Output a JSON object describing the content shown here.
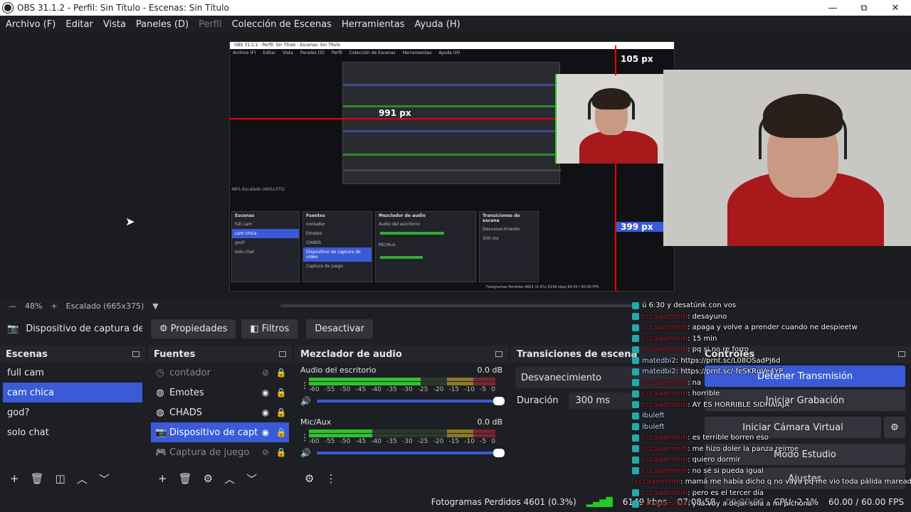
{
  "window": {
    "title": "OBS 31.1.2 - Perfil: Sin Título - Escenas: Sin Título",
    "controls": [
      "—",
      "⧉",
      "✕"
    ]
  },
  "menu": [
    {
      "label": "Archivo (F)",
      "disabled": false
    },
    {
      "label": "Editar",
      "disabled": false
    },
    {
      "label": "Vista",
      "disabled": false
    },
    {
      "label": "Paneles (D)",
      "disabled": false
    },
    {
      "label": "Perfil",
      "disabled": true
    },
    {
      "label": "Colección de Escenas",
      "disabled": false
    },
    {
      "label": "Herramientas",
      "disabled": false
    },
    {
      "label": "Ayuda (H)",
      "disabled": false
    }
  ],
  "preview": {
    "measure_top": "105 px",
    "measure_left": "991 px",
    "measure_right": "399 px",
    "nested_title": "OBS 31.1.2 - Perfil: Sin Título - Escenas: Sin Título",
    "nested_menu": [
      "Archivo (F)",
      "Editar",
      "Vista",
      "Paneles (D)",
      "Perfil",
      "Colección de Escenas",
      "Herramientas",
      "Ayuda (H)"
    ],
    "nested_scale": "48%  Escalado (665x375)",
    "nested_status": "Fotogramas Perdidos 4601 (0.3%)   6149 kbps   60.00 / 60.00 FPS"
  },
  "scale_bar": {
    "minus": "—",
    "zoom": "48%",
    "plus": "+",
    "scaling": "Escalado (665x375)",
    "dropdown": "▼"
  },
  "source_toolbar": {
    "source_name": "Dispositivo de captura de v",
    "properties": "Propiedades",
    "filters": "Filtros",
    "deactivate": "Desactivar"
  },
  "scenes": {
    "title": "Escenas",
    "items": [
      "full cam",
      "cam chica",
      "god?",
      "solo chat"
    ],
    "selected": 1
  },
  "sources": {
    "title": "Fuentes",
    "items": [
      {
        "label": "contador",
        "icon": "clock-icon",
        "visible": false
      },
      {
        "label": "Emotes",
        "icon": "browser-icon",
        "visible": true
      },
      {
        "label": "CHADS",
        "icon": "browser-icon",
        "visible": true
      },
      {
        "label": "Dispositivo de captura de video",
        "icon": "camera-icon",
        "visible": true
      },
      {
        "label": "Captura de juego",
        "icon": "gamepad-icon",
        "visible": false
      }
    ],
    "selected": 3
  },
  "mixer": {
    "title": "Mezclador de audio",
    "channels": [
      {
        "name": "Audio del escritorio",
        "db": "0.0 dB",
        "level": 0.6
      },
      {
        "name": "Mic/Aux",
        "db": "0.0 dB",
        "level": 0.34
      }
    ],
    "ticks": [
      "-60",
      "-55",
      "-50",
      "-45",
      "-40",
      "-35",
      "-30",
      "-25",
      "-20",
      "-15",
      "-10",
      "-5",
      "0"
    ]
  },
  "transitions": {
    "title": "Transiciones de escena",
    "selected": "Desvanecimiento",
    "duration_label": "Duración",
    "duration_value": "300 ms"
  },
  "controls": {
    "title": "Controles",
    "buttons": [
      "Detener Transmisión",
      "Iniciar Grabación",
      "Iniciar Cámara Virtual",
      "Modo Estudio",
      "Ajustes"
    ]
  },
  "status": {
    "dropped": "Fotogramas Perdidos 4601 (0.3%)",
    "kbps": "6149 kbps",
    "stream_time": "07:08:58",
    "rec_time": "00:00:00",
    "cpu": "CPU: 2.1%",
    "fps": "60.00 / 60.00 FPS"
  },
  "chat": [
    {
      "user": "",
      "text": "ú 6:30 y desatúnk con vos"
    },
    {
      "user": "cccaaammm",
      "text": ": desayuno"
    },
    {
      "user": "cccaaammm",
      "text": ": apaga y volve a prender cuando ne despieetw"
    },
    {
      "user": "cccaaammm",
      "text": ": 15 min"
    },
    {
      "user": "cccaaammm",
      "text": ": pq si no re forro"
    },
    {
      "user": "matedbi2",
      "text": ": https://prnt.sc/L08OSadPj6d"
    },
    {
      "user": "matedbi2",
      "text": ": https://prnt.sc/-feSKRqVe4YP"
    },
    {
      "user": "cccaaammm",
      "text": ": na"
    },
    {
      "user": "cccaaammm",
      "text": ": horrible"
    },
    {
      "user": "cccaaammm",
      "text": ": AY ES HORRIBLE SIDHAIAJA"
    },
    {
      "user": "ibuleft",
      "text": ""
    },
    {
      "user": "ibuleft",
      "text": ""
    },
    {
      "user": "cccaaammm",
      "text": ": es terrible borren eso"
    },
    {
      "user": "cccaaammm",
      "text": ": me hizo doler la panza reírme"
    },
    {
      "user": "cccaaammm",
      "text": ": quiero dormir"
    },
    {
      "user": "cccaaammm",
      "text": ": no sé si pueda igual"
    },
    {
      "user": "cccaaammm",
      "text": ": mamá me había dicho q no vaya pq me vio toda pálida mareada"
    },
    {
      "user": "cccaaammm",
      "text": ": pero es el tercer día"
    },
    {
      "user": "cccaaammm",
      "text": ": y la voy a dejar sola a mi pichona"
    }
  ],
  "colors": {
    "accent": "#3b5ad8",
    "measure": "#e00000",
    "shirt": "#a8191c",
    "background": "#1e1f24"
  }
}
